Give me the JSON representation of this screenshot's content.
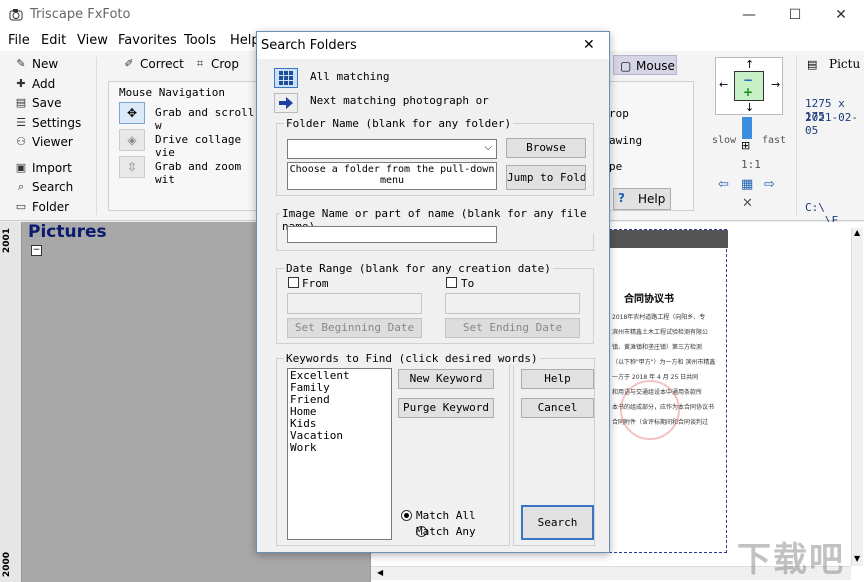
{
  "app": {
    "title": "Triscape FxFoto",
    "minimize": "—",
    "maximize": "☐",
    "close": "✕"
  },
  "menu": [
    "File",
    "Edit",
    "View",
    "Favorites",
    "Tools",
    "Help"
  ],
  "toolbar": {
    "left_buttons": [
      "New",
      "Add",
      "Save",
      "Settings",
      "Viewer",
      "Import",
      "Search",
      "Folder"
    ],
    "correct": "Correct",
    "crop": "Crop",
    "mouse_nav_title": "Mouse Navigation",
    "mouse_nav": [
      "Grab and scroll w",
      "Drive collage vie",
      "Grab and zoom wit"
    ],
    "mouse_tab": "Mouse",
    "right_partial": [
      "rop",
      "awing",
      "pe"
    ],
    "help": "Help",
    "zoom": {
      "slow": "slow",
      "fast": "fast",
      "ratio": "1:1"
    },
    "info": {
      "tab": "Pictu",
      "size": "1275 x 175",
      "date": "2021-02-05",
      "path": "C:\\ ...\\F"
    }
  },
  "left_pane": {
    "title": "Pictures",
    "year_top": "2001",
    "year_bottom": "2000"
  },
  "document": {
    "title": "合同协议书",
    "lines": [
      "2018年农村道路工程（向阳乡、专",
      "滨州市精鑫土木工程试验检测有限公",
      "镇、黄滩镇和垄庄镇）第三方检测",
      "（以下称\"甲方\"）为一方和 滨州市精鑫",
      "一方于 2018 年 4 月 25 日共同",
      "和用语与交通组设本中通用条款所",
      "本书的组成部分，应作为本合同协议书",
      "合同附件（含评标期间和合同谈判过"
    ]
  },
  "dialog": {
    "title": "Search Folders",
    "close": "✕",
    "all_matching": "All matching",
    "next_matching": "Next matching photograph or",
    "folder_group": "Folder Name  (blank for any folder)",
    "browse": "Browse",
    "jump": "Jump to Folder",
    "folder_hint_1": "Choose a folder from the pull-down",
    "folder_hint_2": "menu",
    "image_group": "Image Name or part of name  (blank for any file name)",
    "date_group": "Date Range   (blank for any creation date)",
    "from": "From",
    "to": "To",
    "set_begin": "Set Beginning Date",
    "set_end": "Set Ending Date",
    "keywords_group": "Keywords to Find   (click desired words)",
    "keywords": [
      "Excellent",
      "Family",
      "Friend",
      "Home",
      "Kids",
      "Vacation",
      "Work"
    ],
    "new_keyword": "New Keyword",
    "purge_keyword": "Purge Keyword",
    "help": "Help",
    "cancel": "Cancel",
    "match_all": "Match All",
    "match_any": "Match Any",
    "search": "Search"
  },
  "watermark": "下载吧"
}
